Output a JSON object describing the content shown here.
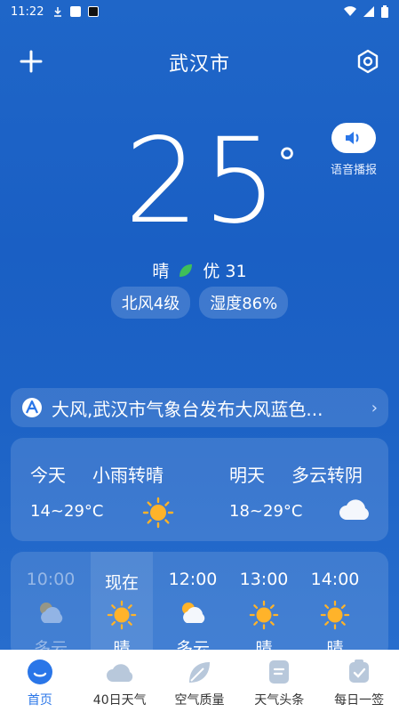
{
  "status_bar": {
    "time": "11:22"
  },
  "header": {
    "city": "武汉市"
  },
  "voice": {
    "label": "语音播报"
  },
  "current": {
    "temperature": "25",
    "degree": "°",
    "condition": "晴",
    "aqi_label": "优 31",
    "wind": "北风4级",
    "humidity": "湿度86%"
  },
  "alert": {
    "text": "大风,武汉市气象台发布大风蓝色..."
  },
  "daily": [
    {
      "day": "今天",
      "condition": "小雨转晴",
      "range": "14~29°C",
      "icon": "sun-icon"
    },
    {
      "day": "明天",
      "condition": "多云转阴",
      "range": "18~29°C",
      "icon": "cloud-icon"
    }
  ],
  "hourly": [
    {
      "time": "10:00",
      "condition": "多云",
      "icon": "partly-cloudy-icon",
      "state": "past"
    },
    {
      "time": "现在",
      "condition": "晴",
      "icon": "sun-icon",
      "state": "now"
    },
    {
      "time": "12:00",
      "condition": "多云",
      "icon": "partly-cloudy-icon",
      "state": "future"
    },
    {
      "time": "13:00",
      "condition": "晴",
      "icon": "sun-icon",
      "state": "future"
    },
    {
      "time": "14:00",
      "condition": "晴",
      "icon": "sun-icon",
      "state": "future"
    }
  ],
  "nav": [
    {
      "label": "首页",
      "icon": "home-icon",
      "active": true
    },
    {
      "label": "40日天气",
      "icon": "cloud-calendar-icon",
      "active": false
    },
    {
      "label": "空气质量",
      "icon": "leaf-icon",
      "active": false
    },
    {
      "label": "天气头条",
      "icon": "news-icon",
      "active": false
    },
    {
      "label": "每日一签",
      "icon": "checkin-icon",
      "active": false
    }
  ],
  "colors": {
    "accent": "#2a76e8",
    "sun": "#ffb32a",
    "leaf": "#3fbf5a"
  }
}
